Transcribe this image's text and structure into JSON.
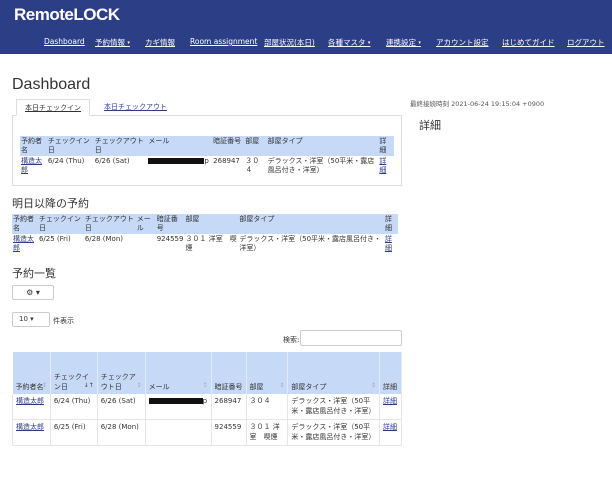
{
  "brand": {
    "logo_main": "Remote",
    "logo_lock": "LOCK"
  },
  "nav": {
    "items": [
      {
        "label": "Dashboard",
        "caret": false
      },
      {
        "label": "予約情報",
        "caret": true
      },
      {
        "label": "カギ情報",
        "caret": false
      },
      {
        "label": "Room assignment",
        "caret": false
      },
      {
        "label": "部屋状況(本日)",
        "caret": false
      },
      {
        "label": "各種マスタ",
        "caret": true
      },
      {
        "label": "連携設定",
        "caret": true
      },
      {
        "label": "アカウント設定",
        "caret": false
      },
      {
        "label": "はじめてガイド",
        "caret": false
      },
      {
        "label": "ログアウト",
        "caret": false
      }
    ]
  },
  "page": {
    "title": "Dashboard",
    "last_connection": "最終接続時刻 2021-06-24 19:15:04 +0900",
    "side_title": "詳細"
  },
  "tabs": [
    {
      "label": "本日チェックイン",
      "active": true
    },
    {
      "label": "本日チェックアウト",
      "active": false
    }
  ],
  "checkin_table": {
    "headers": [
      "予約者名",
      "チェックイン日",
      "チェックアウト日",
      "メール",
      "暗証番号",
      "部屋",
      "部屋タイプ",
      "詳細"
    ],
    "rows": [
      {
        "name": "構造太郎",
        "checkin": "6/24 (Thu)",
        "checkout": "6/26 (Sat)",
        "email_suffix": "p",
        "pin": "268947",
        "room": "３０４",
        "room_type": "デラックス・洋室（50平米・露店風呂付き・洋室）",
        "detail": "詳細"
      }
    ]
  },
  "upcoming": {
    "title": "明日以降の予約",
    "headers": [
      "予約者名",
      "チェックイン日",
      "チェックアウト日",
      "メール",
      "暗証番号",
      "部屋",
      "部屋タイプ",
      "詳細"
    ],
    "rows": [
      {
        "name": "構造太郎",
        "checkin": "6/25 (Fri)",
        "checkout": "6/28 (Mon)",
        "email": "",
        "pin": "924559",
        "room": "３０１ 洋室　喫煙",
        "room_type": "デラックス・洋室（50平米・露店風呂付き・洋室）",
        "detail": "詳細"
      }
    ]
  },
  "list": {
    "title": "予約一覧",
    "gear_caret": "▾",
    "page_length": "10",
    "page_length_caret": "▾",
    "page_length_label": "件表示",
    "search_label": "検索:",
    "headers": [
      "予約者名",
      "チェックイン日",
      "チェックアウト日",
      "メール",
      "暗証番号",
      "部屋",
      "部屋タイプ",
      "詳細"
    ],
    "sort_marks": [
      "↕",
      "↓↑",
      "↕",
      "↕",
      "↕",
      "↕",
      "↕",
      ""
    ],
    "rows": [
      {
        "name": "構造太郎",
        "checkin": "6/24 (Thu)",
        "checkout": "6/26 (Sat)",
        "email_tail": "p",
        "pin": "268947",
        "room": "３０４",
        "room_type": "デラックス・洋室（50平米・露店風呂付き・洋室）",
        "detail": "詳細"
      },
      {
        "name": "構造太郎",
        "checkin": "6/25 (Fri)",
        "checkout": "6/28 (Mon)",
        "email_tail": "",
        "pin": "924559",
        "room": "３０１ 洋室　喫煙",
        "room_type": "デラックス・洋室（50平米・露店風呂付き・洋室）",
        "detail": "詳細"
      }
    ]
  },
  "colors": {
    "navbar": "#2c3e86",
    "table_header": "#c6d9f7",
    "link": "#2c3e86"
  }
}
